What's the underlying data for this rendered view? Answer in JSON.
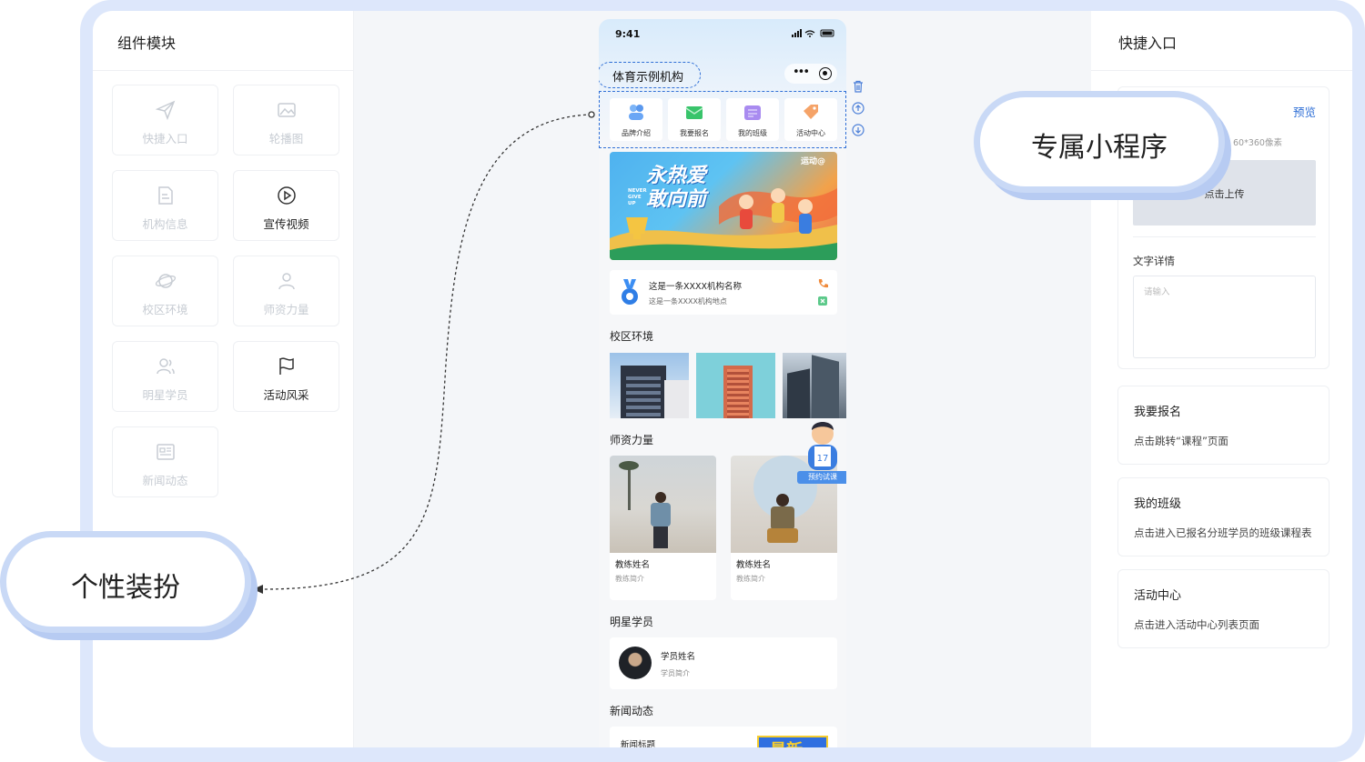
{
  "left_panel": {
    "title": "组件模块",
    "items": [
      {
        "label": "快捷入口",
        "icon": "send-icon",
        "enabled": false
      },
      {
        "label": "轮播图",
        "icon": "image-icon",
        "enabled": false
      },
      {
        "label": "机构信息",
        "icon": "document-icon",
        "enabled": false
      },
      {
        "label": "宣传视频",
        "icon": "play-circle-icon",
        "enabled": true
      },
      {
        "label": "校区环境",
        "icon": "planet-icon",
        "enabled": false
      },
      {
        "label": "师资力量",
        "icon": "person-icon",
        "enabled": false
      },
      {
        "label": "明星学员",
        "icon": "users-icon",
        "enabled": false
      },
      {
        "label": "活动风采",
        "icon": "flag-icon",
        "enabled": true
      },
      {
        "label": "新闻动态",
        "icon": "newspaper-icon",
        "enabled": false
      }
    ]
  },
  "phone": {
    "time": "9:41",
    "org_name": "体育示例机构",
    "quick_entries": [
      {
        "label": "品牌介绍",
        "color": "#6aa6f5"
      },
      {
        "label": "我要报名",
        "color": "#39c46b"
      },
      {
        "label": "我的班级",
        "color": "#a98bf0"
      },
      {
        "label": "活动中心",
        "color": "#f5a368"
      }
    ],
    "banner": {
      "title": "永热爱 敢向前",
      "side_text": "NEVER GIVE UP",
      "badge": "运动@"
    },
    "org_info": {
      "name": "这是一条XXXX机构名称",
      "address": "这是一条XXXX机构地点"
    },
    "campus": {
      "title": "校区环境"
    },
    "teachers": {
      "title": "师资力量",
      "cta": "预约试课",
      "items": [
        {
          "name": "教练姓名",
          "intro": "教练简介"
        },
        {
          "name": "教练姓名",
          "intro": "教练简介"
        }
      ]
    },
    "stars": {
      "title": "明星学员",
      "student_name": "学员姓名",
      "student_intro": "学员简介"
    },
    "news": {
      "title": "新闻动态",
      "item_title": "新闻标题",
      "badge": "最新"
    }
  },
  "right_panel": {
    "title": "快捷入口",
    "preview": "预览",
    "image_hint": "60*360像素",
    "upload": "点击上传",
    "text_detail_label": "文字详情",
    "text_placeholder": "请输入",
    "links": [
      {
        "title": "我要报名",
        "desc": "点击跳转“课程”页面"
      },
      {
        "title": "我的班级",
        "desc": "点击进入已报名分班学员的班级课程表"
      },
      {
        "title": "活动中心",
        "desc": "点击进入活动中心列表页面"
      }
    ]
  },
  "callouts": {
    "mini_program": "专属小程序",
    "personalize": "个性装扮"
  }
}
